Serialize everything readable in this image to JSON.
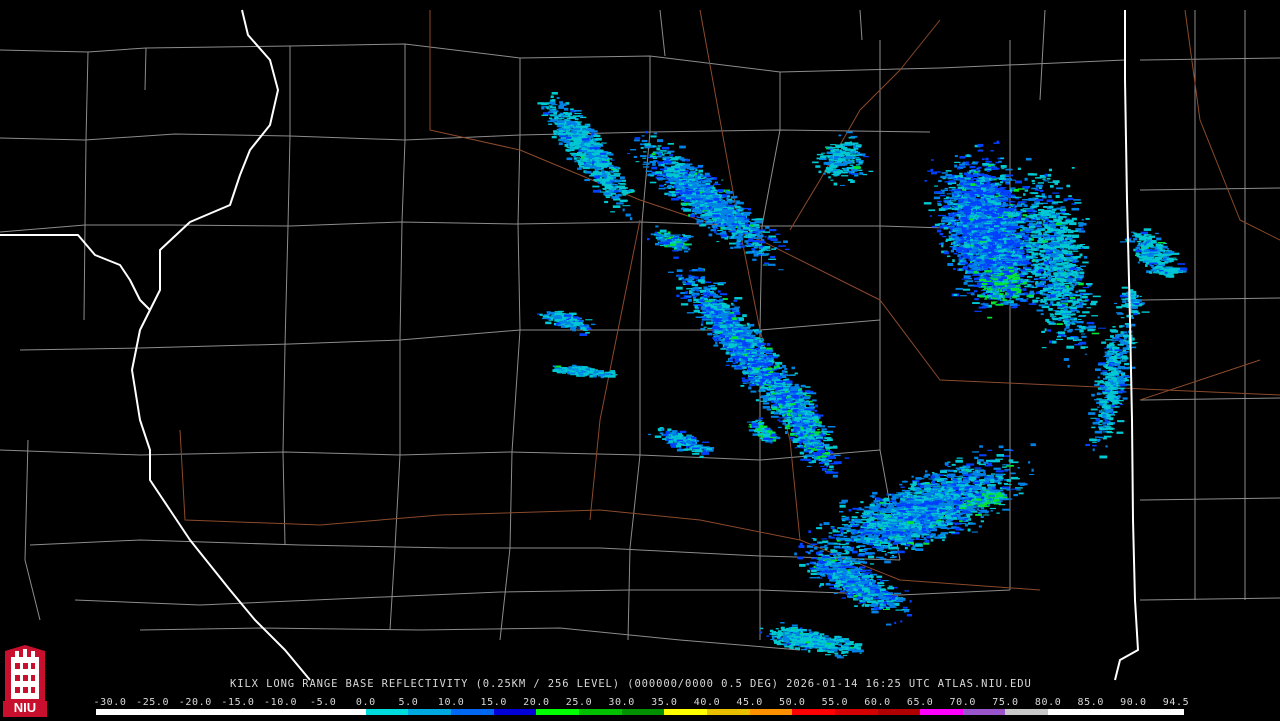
{
  "caption": {
    "site": "KILX",
    "product": "LONG RANGE BASE REFLECTIVITY",
    "resolution": "(0.25KM / 256 LEVEL)",
    "volume": "(000000/0000 0.5 DEG)",
    "timestamp": "2026-01-14 16:25 UTC",
    "source": "ATLAS.NIU.EDU"
  },
  "scale": {
    "labels": [
      "-30.0",
      "-25.0",
      "-20.0",
      "-15.0",
      "-10.0",
      "-5.0",
      "0.0",
      "5.0",
      "10.0",
      "15.0",
      "20.0",
      "25.0",
      "30.0",
      "35.0",
      "40.0",
      "45.0",
      "50.0",
      "55.0",
      "60.0",
      "65.0",
      "70.0",
      "75.0",
      "80.0",
      "85.0",
      "90.0",
      "94.5"
    ],
    "colors": [
      "#ffffff",
      "#ffffff",
      "#ffffff",
      "#ffffff",
      "#ffffff",
      "#ffffff",
      "#00dcdc",
      "#00a8e0",
      "#0068f0",
      "#0000d8",
      "#00ff00",
      "#00c000",
      "#009000",
      "#ffff00",
      "#e8c000",
      "#ff9000",
      "#ff0000",
      "#d40000",
      "#b00000",
      "#ff00ff",
      "#9955c9",
      "#c8c8c8",
      "#ffffff",
      "#ffffff",
      "#ffffff"
    ]
  },
  "logo": {
    "text": "NIU",
    "color": "#c8102e"
  },
  "map": {
    "background": "#000000",
    "county_color": "#8c8c8c",
    "state_color": "#ffffff",
    "road_color": "#8b4a2b",
    "echo_colors": {
      "light": "#00c8d2",
      "medium": "#0082e6",
      "heavy": "#0040ff",
      "core": "#00e632"
    }
  }
}
